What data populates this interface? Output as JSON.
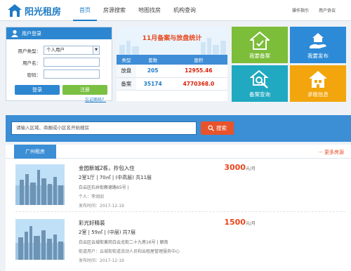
{
  "header": {
    "logo_text": "阳光租房",
    "nav": [
      "首页",
      "房源搜索",
      "地图找房",
      "机构查询"
    ],
    "links": [
      "操作指引",
      "用户协议"
    ]
  },
  "login": {
    "title": "用户登录",
    "type_label": "用户类型：",
    "type_value": "个人用户",
    "username_label": "用户名：",
    "password_label": "密码：",
    "login_button": "登录",
    "register_button": "注册",
    "forgot": "忘记密码？"
  },
  "stats": {
    "title": "11月备案与放盘统计",
    "headers": [
      "类型",
      "套数",
      "面积"
    ],
    "rows": [
      {
        "type": "放盘",
        "count": "205",
        "area": "12955.46"
      },
      {
        "type": "备案",
        "count": "35174",
        "area": "4770368.0"
      }
    ]
  },
  "tiles": [
    "我要备案",
    "我要发布",
    "备案查询",
    "求租信息"
  ],
  "search": {
    "placeholder": "请输入区域、商圈或小区名开始搜房",
    "button": "搜索"
  },
  "listing": {
    "tab": "广州租房",
    "more": "··· 更多房源",
    "items": [
      {
        "title": "金园新城2栋，拎包入住",
        "spec": "2室1厅 | 70㎡ | (中高层) 共11层",
        "address": "白云区石井街教德路65号 |",
        "person": "个人：李润旧",
        "date": "发布时间：2017-12-19",
        "price": "3000",
        "unit": "元/月"
      },
      {
        "title": "彩光好精装",
        "spec": "2室 | 59㎡ | (中层) 共7层",
        "address": "白云区云城街黄岗白云北街二十九巷16号 | 朝南",
        "person": "街道用户：云城街街道流动人员和出租屋管理服务中心",
        "date": "发布时间：2017-12-19",
        "price": "1500",
        "unit": "元/月"
      }
    ]
  },
  "colors": {
    "primary": "#2d87d0",
    "accent": "#e8461b",
    "green": "#7cbd3a",
    "cyan": "#20a9c1",
    "orange": "#f2a50c"
  }
}
